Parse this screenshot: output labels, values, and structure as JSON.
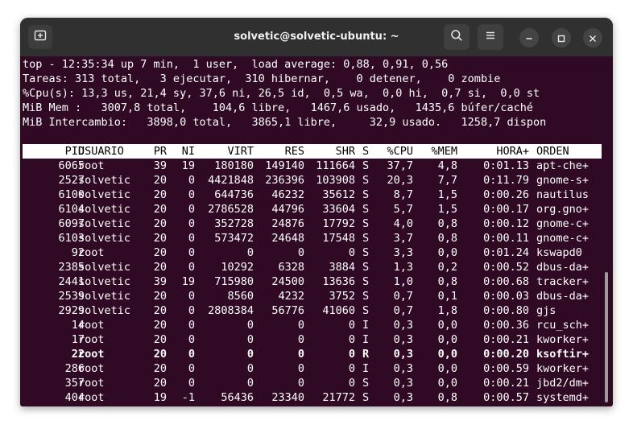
{
  "window": {
    "title": "solvetic@solvetic-ubuntu: ~"
  },
  "icons": {
    "new_tab": "new-tab-icon",
    "search": "search-icon",
    "menu": "hamburger-menu-icon",
    "minimize": "minimize-icon",
    "maximize": "maximize-icon",
    "close": "close-icon"
  },
  "colors": {
    "terminal_bg": "#300a24",
    "titlebar_bg": "#303030",
    "text": "#ffffff",
    "header_bg": "#ffffff"
  },
  "summary": [
    "top - 12:35:34 up 7 min,  1 user,  load average: 0,88, 0,91, 0,56",
    "Tareas: 313 total,   3 ejecutar,  310 hibernar,    0 detener,    0 zombie",
    "%Cpu(s): 13,3 us, 21,4 sy, 37,6 ni, 26,5 id,  0,5 wa,  0,0 hi,  0,7 si,  0,0 st",
    "MiB Mem :   3007,8 total,    104,6 libre,   1467,6 usado,   1435,6 búfer/caché",
    "MiB Intercambio:   3898,0 total,   3865,1 libre,     32,9 usado.   1258,7 dispon"
  ],
  "table": {
    "headers": {
      "pid": "PID",
      "user": "USUARIO",
      "pr": "PR",
      "ni": "NI",
      "virt": "VIRT",
      "res": "RES",
      "shr": "SHR",
      "s": "S",
      "cpu": "%CPU",
      "mem": "%MEM",
      "time": "HORA+",
      "cmd": "ORDEN"
    },
    "rows": [
      {
        "pid": "6065",
        "user": "root",
        "pr": "39",
        "ni": "19",
        "virt": "180180",
        "res": "149140",
        "shr": "111664",
        "s": "S",
        "cpu": "37,7",
        "mem": "4,8",
        "time": "0:01.13",
        "cmd": "apt-che+",
        "bold": false
      },
      {
        "pid": "2527",
        "user": "solvetic",
        "pr": "20",
        "ni": "0",
        "virt": "4421848",
        "res": "236396",
        "shr": "103908",
        "s": "S",
        "cpu": "20,3",
        "mem": "7,7",
        "time": "0:11.79",
        "cmd": "gnome-s+",
        "bold": false
      },
      {
        "pid": "6100",
        "user": "solvetic",
        "pr": "20",
        "ni": "0",
        "virt": "644736",
        "res": "46232",
        "shr": "35612",
        "s": "S",
        "cpu": "8,7",
        "mem": "1,5",
        "time": "0:00.26",
        "cmd": "nautilus",
        "bold": false
      },
      {
        "pid": "6104",
        "user": "solvetic",
        "pr": "20",
        "ni": "0",
        "virt": "2786528",
        "res": "44796",
        "shr": "33604",
        "s": "S",
        "cpu": "5,7",
        "mem": "1,5",
        "time": "0:00.17",
        "cmd": "org.gno+",
        "bold": false
      },
      {
        "pid": "6097",
        "user": "solvetic",
        "pr": "20",
        "ni": "0",
        "virt": "352728",
        "res": "24876",
        "shr": "17792",
        "s": "S",
        "cpu": "4,0",
        "mem": "0,8",
        "time": "0:00.12",
        "cmd": "gnome-c+",
        "bold": false
      },
      {
        "pid": "6103",
        "user": "solvetic",
        "pr": "20",
        "ni": "0",
        "virt": "573472",
        "res": "24648",
        "shr": "17548",
        "s": "S",
        "cpu": "3,7",
        "mem": "0,8",
        "time": "0:00.11",
        "cmd": "gnome-c+",
        "bold": false
      },
      {
        "pid": "92",
        "user": "root",
        "pr": "20",
        "ni": "0",
        "virt": "0",
        "res": "0",
        "shr": "0",
        "s": "S",
        "cpu": "3,3",
        "mem": "0,0",
        "time": "0:01.24",
        "cmd": "kswapd0",
        "bold": false
      },
      {
        "pid": "2385",
        "user": "solvetic",
        "pr": "20",
        "ni": "0",
        "virt": "10292",
        "res": "6328",
        "shr": "3884",
        "s": "S",
        "cpu": "1,3",
        "mem": "0,2",
        "time": "0:00.52",
        "cmd": "dbus-da+",
        "bold": false
      },
      {
        "pid": "2441",
        "user": "solvetic",
        "pr": "39",
        "ni": "19",
        "virt": "715980",
        "res": "24500",
        "shr": "13636",
        "s": "S",
        "cpu": "1,0",
        "mem": "0,8",
        "time": "0:00.68",
        "cmd": "tracker+",
        "bold": false
      },
      {
        "pid": "2539",
        "user": "solvetic",
        "pr": "20",
        "ni": "0",
        "virt": "8560",
        "res": "4232",
        "shr": "3752",
        "s": "S",
        "cpu": "0,7",
        "mem": "0,1",
        "time": "0:00.03",
        "cmd": "dbus-da+",
        "bold": false
      },
      {
        "pid": "2929",
        "user": "solvetic",
        "pr": "20",
        "ni": "0",
        "virt": "2808384",
        "res": "56776",
        "shr": "41060",
        "s": "S",
        "cpu": "0,7",
        "mem": "1,8",
        "time": "0:00.80",
        "cmd": "gjs",
        "bold": false
      },
      {
        "pid": "14",
        "user": "root",
        "pr": "20",
        "ni": "0",
        "virt": "0",
        "res": "0",
        "shr": "0",
        "s": "I",
        "cpu": "0,3",
        "mem": "0,0",
        "time": "0:00.36",
        "cmd": "rcu_sch+",
        "bold": false
      },
      {
        "pid": "17",
        "user": "root",
        "pr": "20",
        "ni": "0",
        "virt": "0",
        "res": "0",
        "shr": "0",
        "s": "I",
        "cpu": "0,3",
        "mem": "0,0",
        "time": "0:00.21",
        "cmd": "kworker+",
        "bold": false
      },
      {
        "pid": "22",
        "user": "root",
        "pr": "20",
        "ni": "0",
        "virt": "0",
        "res": "0",
        "shr": "0",
        "s": "R",
        "cpu": "0,3",
        "mem": "0,0",
        "time": "0:00.20",
        "cmd": "ksoftir+",
        "bold": true
      },
      {
        "pid": "286",
        "user": "root",
        "pr": "20",
        "ni": "0",
        "virt": "0",
        "res": "0",
        "shr": "0",
        "s": "I",
        "cpu": "0,3",
        "mem": "0,0",
        "time": "0:00.59",
        "cmd": "kworker+",
        "bold": false
      },
      {
        "pid": "357",
        "user": "root",
        "pr": "20",
        "ni": "0",
        "virt": "0",
        "res": "0",
        "shr": "0",
        "s": "S",
        "cpu": "0,3",
        "mem": "0,0",
        "time": "0:00.21",
        "cmd": "jbd2/dm+",
        "bold": false
      },
      {
        "pid": "404",
        "user": "root",
        "pr": "19",
        "ni": "-1",
        "virt": "56436",
        "res": "23340",
        "shr": "21772",
        "s": "S",
        "cpu": "0,3",
        "mem": "0,8",
        "time": "0:00.57",
        "cmd": "systemd+",
        "bold": false
      }
    ]
  }
}
